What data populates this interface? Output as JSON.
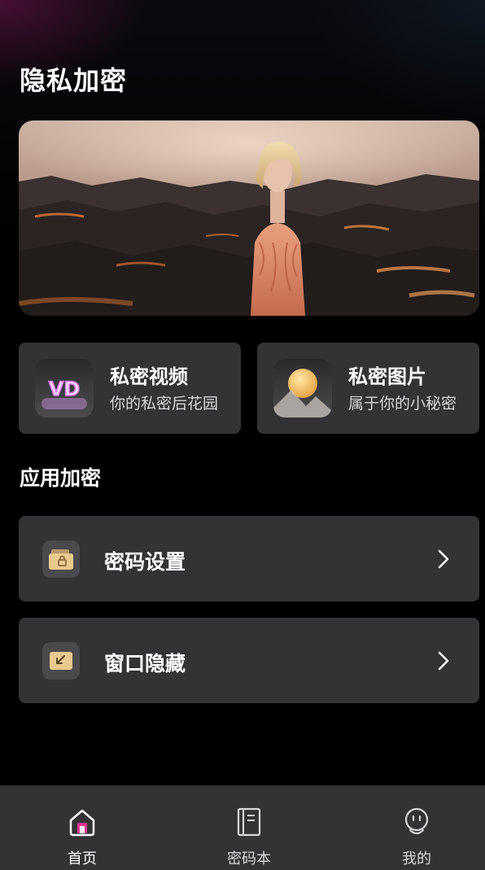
{
  "header": {
    "title": "隐私加密"
  },
  "features": [
    {
      "title": "私密视频",
      "subtitle": "你的私密后花园",
      "icon": "vd-video-icon",
      "icon_text": "VD"
    },
    {
      "title": "私密图片",
      "subtitle": "属于你的小秘密",
      "icon": "sun-photo-icon"
    }
  ],
  "app_encryption": {
    "title": "应用加密",
    "items": [
      {
        "label": "密码设置",
        "icon": "lock-folder-icon"
      },
      {
        "label": "窗口隐藏",
        "icon": "minimize-window-icon"
      }
    ]
  },
  "tabbar": {
    "items": [
      {
        "label": "首页",
        "icon": "home-icon",
        "active": true
      },
      {
        "label": "密码本",
        "icon": "notebook-icon",
        "active": false
      },
      {
        "label": "我的",
        "icon": "profile-icon",
        "active": false
      }
    ]
  },
  "colors": {
    "background": "#000000",
    "card": "#333335",
    "accent_pink": "#e0368f",
    "text_secondary": "#d5d5d5"
  }
}
